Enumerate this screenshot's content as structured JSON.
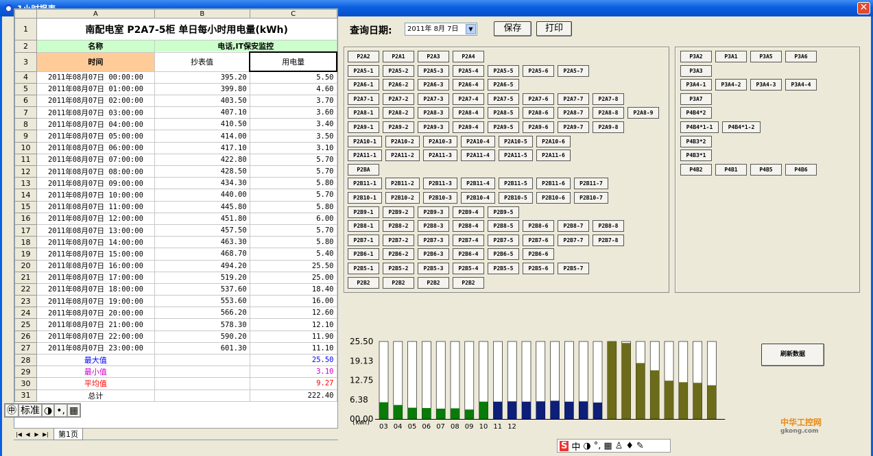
{
  "window": {
    "title": "1小时报表"
  },
  "sheet": {
    "col_headers": [
      "A",
      "B",
      "C"
    ],
    "title": "南配电室 P2A7-5柜 单日每小时用电量(kWh)",
    "r2_name": "名称",
    "r2_group": "电话,IT保安监控",
    "r3_time": "时间",
    "r3_reading": "抄表值",
    "r3_usage": "用电量",
    "rows": [
      [
        "2011年08月07日 00:00:00",
        "395.20",
        "5.50"
      ],
      [
        "2011年08月07日 01:00:00",
        "399.80",
        "4.60"
      ],
      [
        "2011年08月07日 02:00:00",
        "403.50",
        "3.70"
      ],
      [
        "2011年08月07日 03:00:00",
        "407.10",
        "3.60"
      ],
      [
        "2011年08月07日 04:00:00",
        "410.50",
        "3.40"
      ],
      [
        "2011年08月07日 05:00:00",
        "414.00",
        "3.50"
      ],
      [
        "2011年08月07日 06:00:00",
        "417.10",
        "3.10"
      ],
      [
        "2011年08月07日 07:00:00",
        "422.80",
        "5.70"
      ],
      [
        "2011年08月07日 08:00:00",
        "428.50",
        "5.70"
      ],
      [
        "2011年08月07日 09:00:00",
        "434.30",
        "5.80"
      ],
      [
        "2011年08月07日 10:00:00",
        "440.00",
        "5.70"
      ],
      [
        "2011年08月07日 11:00:00",
        "445.80",
        "5.80"
      ],
      [
        "2011年08月07日 12:00:00",
        "451.80",
        "6.00"
      ],
      [
        "2011年08月07日 13:00:00",
        "457.50",
        "5.70"
      ],
      [
        "2011年08月07日 14:00:00",
        "463.30",
        "5.80"
      ],
      [
        "2011年08月07日 15:00:00",
        "468.70",
        "5.40"
      ],
      [
        "2011年08月07日 16:00:00",
        "494.20",
        "25.50"
      ],
      [
        "2011年08月07日 17:00:00",
        "519.20",
        "25.00"
      ],
      [
        "2011年08月07日 18:00:00",
        "537.60",
        "18.40"
      ],
      [
        "2011年08月07日 19:00:00",
        "553.60",
        "16.00"
      ],
      [
        "2011年08月07日 20:00:00",
        "566.20",
        "12.60"
      ],
      [
        "2011年08月07日 21:00:00",
        "578.30",
        "12.10"
      ],
      [
        "2011年08月07日 22:00:00",
        "590.20",
        "11.90"
      ],
      [
        "2011年08月07日 23:00:00",
        "601.30",
        "11.10"
      ]
    ],
    "max_label": "最大值",
    "max_value": "25.50",
    "min_label": "最小值",
    "min_value": "3.10",
    "avg_label": "平均值",
    "avg_value": "9.27",
    "total_label": "总计",
    "total_value": "222.40",
    "row_numbers": [
      "1",
      "2",
      "3",
      "4",
      "5",
      "6",
      "7",
      "8",
      "9",
      "10",
      "11",
      "12",
      "13",
      "14",
      "15",
      "16",
      "17",
      "18",
      "19",
      "20",
      "21",
      "22",
      "23",
      "24",
      "25",
      "26",
      "27",
      "28",
      "29",
      "30",
      "31"
    ],
    "tab_label": "第1页"
  },
  "ime": {
    "label": "标准"
  },
  "query": {
    "label": "查询日期:",
    "date": "2011年 8月 7日",
    "save": "保存",
    "print": "打印"
  },
  "left_buttons": [
    [
      "P2A2",
      "P2A1",
      "P2A3",
      "P2A4"
    ],
    [
      "P2A5-1",
      "P2A5-2",
      "P2A5-3",
      "P2A5-4",
      "P2A5-5",
      "P2A5-6",
      "P2A5-7"
    ],
    [
      "P2A6-1",
      "P2A6-2",
      "P2A6-3",
      "P2A6-4",
      "P2A6-5"
    ],
    [
      "P2A7-1",
      "P2A7-2",
      "P2A7-3",
      "P2A7-4",
      "P2A7-5",
      "P2A7-6",
      "P2A7-7",
      "P2A7-8"
    ],
    [
      "P2A8-1",
      "P2A8-2",
      "P2A8-3",
      "P2A8-4",
      "P2A8-5",
      "P2A8-6",
      "P2A8-7",
      "P2A8-8",
      "P2A8-9"
    ],
    [
      "P2A9-1",
      "P2A9-2",
      "P2A9-3",
      "P2A9-4",
      "P2A9-5",
      "P2A9-6",
      "P2A9-7",
      "P2A9-8"
    ],
    [
      "P2A10-1",
      "P2A10-2",
      "P2A10-3",
      "P2A10-4",
      "P2A10-5",
      "P2A10-6"
    ],
    [
      "P2A11-1",
      "P2A11-2",
      "P2A11-3",
      "P2A11-4",
      "P2A11-5",
      "P2A11-6"
    ],
    [
      "P2BA"
    ],
    [
      "P2B11-1",
      "P2B11-2",
      "P2B11-3",
      "P2B11-4",
      "P2B11-5",
      "P2B11-6",
      "P2B11-7"
    ],
    [
      "P2B10-1",
      "P2B10-2",
      "P2B10-3",
      "P2B10-4",
      "P2B10-5",
      "P2B10-6",
      "P2B10-7"
    ],
    [
      "P2B9-1",
      "P2B9-2",
      "P2B9-3",
      "P2B9-4",
      "P2B9-5"
    ],
    [
      "P2B8-1",
      "P2B8-2",
      "P2B8-3",
      "P2B8-4",
      "P2B8-5",
      "P2B8-6",
      "P2B8-7",
      "P2B8-8"
    ],
    [
      "P2B7-1",
      "P2B7-2",
      "P2B7-3",
      "P2B7-4",
      "P2B7-5",
      "P2B7-6",
      "P2B7-7",
      "P2B7-8"
    ],
    [
      "P2B6-1",
      "P2B6-2",
      "P2B6-3",
      "P2B6-4",
      "P2B6-5",
      "P2B6-6"
    ],
    [
      "P2B5-1",
      "P2B5-2",
      "P2B5-3",
      "P2B5-4",
      "P2B5-5",
      "P2B5-6",
      "P2B5-7"
    ],
    [
      "P2B2",
      "P2B2",
      "P2B2",
      "P2B2"
    ]
  ],
  "right_buttons": [
    [
      "P3A2",
      "P3A1",
      "P3A5",
      "P3A6"
    ],
    [
      "P3A3"
    ],
    [
      "P3A4-1",
      "P3A4-2",
      "P3A4-3",
      "P3A4-4"
    ],
    [
      "P3A7"
    ],
    [
      "P4B4*2"
    ],
    [
      "P4B4*1-1",
      "P4B4*1-2"
    ],
    [
      "P4B3*2"
    ],
    [
      "P4B3*1"
    ],
    [
      "P4B2",
      "P4B1",
      "P4B5",
      "P4B6"
    ]
  ],
  "refresh_button": "刷新数据",
  "chart_data": {
    "type": "bar",
    "ylim": [
      0,
      25.5
    ],
    "yticks": [
      "25.50",
      "19.13",
      "12.75",
      "6.38",
      "00.00"
    ],
    "ylabel": "(kWh)",
    "xlabels": [
      "03",
      "04",
      "05",
      "06",
      "07",
      "08",
      "09",
      "10",
      "11",
      "12"
    ],
    "values": [
      5.5,
      4.6,
      3.7,
      3.6,
      3.4,
      3.5,
      3.1,
      5.7,
      5.7,
      5.8,
      5.7,
      5.8,
      6.0,
      5.7,
      5.8,
      5.4,
      25.5,
      25.0,
      18.4,
      16.0,
      12.6,
      12.1,
      11.9,
      11.1
    ],
    "colors": [
      "#0a7a0a",
      "#0a7a0a",
      "#0a7a0a",
      "#0a7a0a",
      "#0a7a0a",
      "#0a7a0a",
      "#0a7a0a",
      "#0a7a0a",
      "#0d1f78",
      "#0d1f78",
      "#0d1f78",
      "#0d1f78",
      "#0d1f78",
      "#0d1f78",
      "#0d1f78",
      "#0d1f78",
      "#6b6b1a",
      "#6b6b1a",
      "#6b6b1a",
      "#6b6b1a",
      "#6b6b1a",
      "#6b6b1a",
      "#6b6b1a",
      "#6b6b1a"
    ]
  },
  "watermark": {
    "name": "中华工控网",
    "url": "gkong.com"
  }
}
